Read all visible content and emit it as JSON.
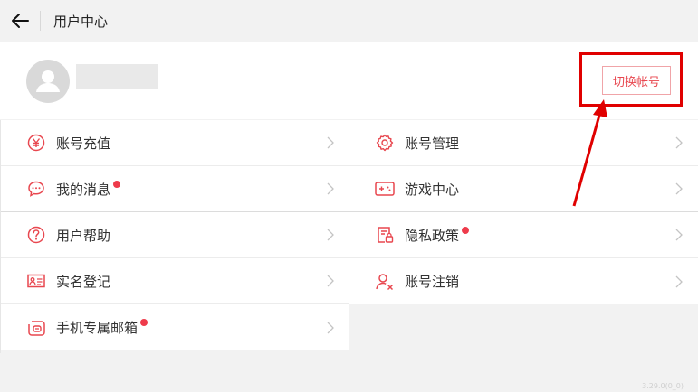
{
  "header": {
    "title": "用户中心"
  },
  "profile": {
    "switch_account_label": "切换帐号"
  },
  "menu": {
    "left": [
      {
        "label": "账号充值",
        "icon": "yen-icon",
        "dot": false
      },
      {
        "label": "我的消息",
        "icon": "chat-bubble-icon",
        "dot": true
      },
      {
        "label": "用户帮助",
        "icon": "help-circle-icon",
        "dot": false
      },
      {
        "label": "实名登记",
        "icon": "id-card-icon",
        "dot": false
      },
      {
        "label": "手机专属邮箱",
        "icon": "mailbox-icon",
        "dot": true
      }
    ],
    "right": [
      {
        "label": "账号管理",
        "icon": "gear-icon",
        "dot": false
      },
      {
        "label": "游戏中心",
        "icon": "gamepad-icon",
        "dot": false
      },
      {
        "label": "隐私政策",
        "icon": "privacy-document-icon",
        "dot": true
      },
      {
        "label": "账号注销",
        "icon": "user-remove-icon",
        "dot": false
      }
    ]
  },
  "version": "3.29.0(0_0)",
  "colors": {
    "accent": "#e8474f",
    "highlight": "#e00000",
    "badge": "#ee3b4b"
  }
}
